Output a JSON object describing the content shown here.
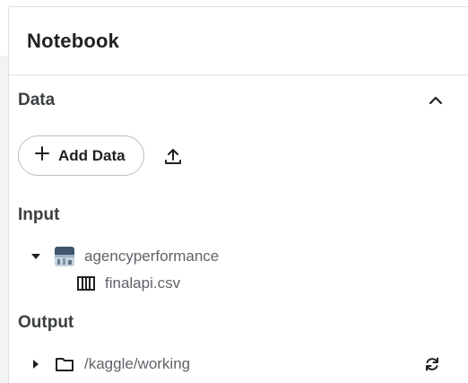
{
  "panel": {
    "title": "Notebook"
  },
  "data_section": {
    "title": "Data",
    "collapse_icon": "chevron-up-icon",
    "add_data_label": "Add Data",
    "add_icon": "plus-icon",
    "upload_icon": "upload-icon"
  },
  "input": {
    "title": "Input",
    "dataset": {
      "name": "agencyperformance",
      "expanded": true,
      "icon": "dataset-thumbnail"
    },
    "files": [
      {
        "name": "finalapi.csv",
        "icon": "table-columns-icon"
      }
    ]
  },
  "output": {
    "title": "Output",
    "folder": {
      "path": "/kaggle/working",
      "expanded": false,
      "icon": "folder-icon"
    },
    "refresh_icon": "refresh-icon"
  },
  "colors": {
    "text": "#202124",
    "muted": "#5f6368",
    "border": "#e0e0e0"
  }
}
